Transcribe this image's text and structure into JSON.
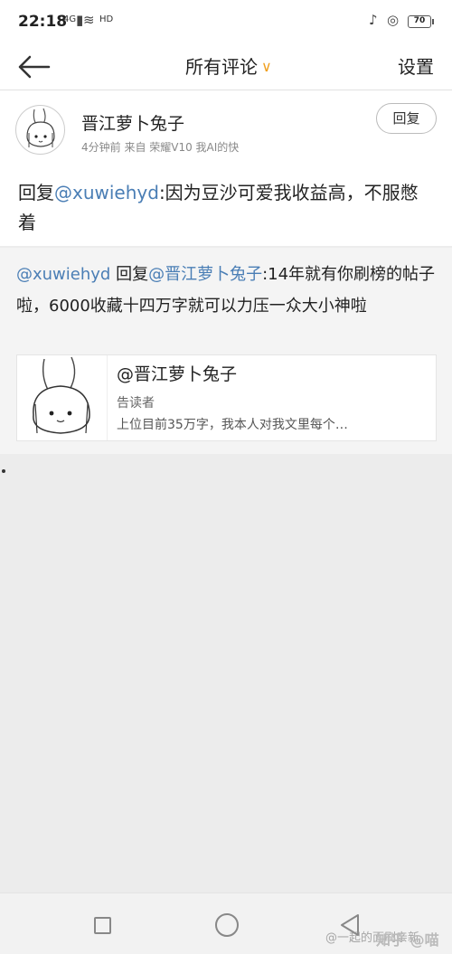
{
  "status": {
    "time": "22:18",
    "network": "4G",
    "wifi": "HD",
    "battery": "70"
  },
  "nav": {
    "title": "所有评论",
    "settings": "设置"
  },
  "comment": {
    "author": "晋江萝卜兔子",
    "meta": "4分钟前  来自 荣耀V10 我AI的快",
    "reply_button": "回复",
    "prefix": "回复",
    "mention": "@xuwiehyd",
    "body": ":因为豆沙可爱我收益高，不服憋着"
  },
  "quote": {
    "user": "@xuwiehyd",
    "reply_word": " 回复",
    "target": "@晋江萝卜兔子",
    "body": ":14年就有你刷榜的帖子啦，6000收藏十四万字就可以力压一众大小神啦"
  },
  "card": {
    "title": "@晋江萝卜兔子",
    "subtitle": "告读者",
    "desc": "上位目前35万字，我本人对我文里每个…"
  },
  "watermark": {
    "main": "知乎 @喵喵喵",
    "sub": "@一起的面刷亲新"
  }
}
